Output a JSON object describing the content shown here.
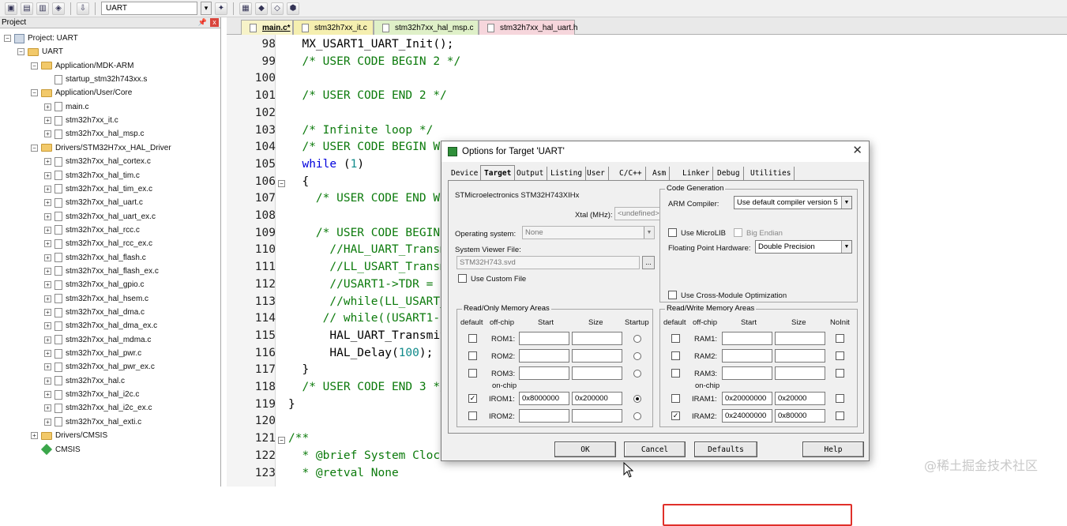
{
  "toolbar": {
    "target": "UART",
    "icons": [
      "save-all-icon",
      "target-options-icon",
      "manage-icon",
      "batch-build-icon",
      "load-icon",
      "select-target-icon",
      "options-icon",
      "multi-project-icon",
      "pack-installer-icon",
      "components-icon",
      "run-env-icon"
    ]
  },
  "project": {
    "header": "Project",
    "tree": [
      {
        "label": "Project: UART",
        "level": 0,
        "kind": "proj",
        "exp": "-"
      },
      {
        "label": "UART",
        "level": 1,
        "kind": "folder",
        "exp": "-"
      },
      {
        "label": "Application/MDK-ARM",
        "level": 2,
        "kind": "folder",
        "exp": "-"
      },
      {
        "label": "startup_stm32h743xx.s",
        "level": 3,
        "kind": "file",
        "exp": ""
      },
      {
        "label": "Application/User/Core",
        "level": 2,
        "kind": "folder",
        "exp": "-"
      },
      {
        "label": "main.c",
        "level": 3,
        "kind": "file",
        "exp": "+"
      },
      {
        "label": "stm32h7xx_it.c",
        "level": 3,
        "kind": "file",
        "exp": "+"
      },
      {
        "label": "stm32h7xx_hal_msp.c",
        "level": 3,
        "kind": "file",
        "exp": "+"
      },
      {
        "label": "Drivers/STM32H7xx_HAL_Driver",
        "level": 2,
        "kind": "folder",
        "exp": "-"
      },
      {
        "label": "stm32h7xx_hal_cortex.c",
        "level": 3,
        "kind": "file",
        "exp": "+"
      },
      {
        "label": "stm32h7xx_hal_tim.c",
        "level": 3,
        "kind": "file",
        "exp": "+"
      },
      {
        "label": "stm32h7xx_hal_tim_ex.c",
        "level": 3,
        "kind": "file",
        "exp": "+"
      },
      {
        "label": "stm32h7xx_hal_uart.c",
        "level": 3,
        "kind": "file",
        "exp": "+"
      },
      {
        "label": "stm32h7xx_hal_uart_ex.c",
        "level": 3,
        "kind": "file",
        "exp": "+"
      },
      {
        "label": "stm32h7xx_hal_rcc.c",
        "level": 3,
        "kind": "file",
        "exp": "+"
      },
      {
        "label": "stm32h7xx_hal_rcc_ex.c",
        "level": 3,
        "kind": "file",
        "exp": "+"
      },
      {
        "label": "stm32h7xx_hal_flash.c",
        "level": 3,
        "kind": "file",
        "exp": "+"
      },
      {
        "label": "stm32h7xx_hal_flash_ex.c",
        "level": 3,
        "kind": "file",
        "exp": "+"
      },
      {
        "label": "stm32h7xx_hal_gpio.c",
        "level": 3,
        "kind": "file",
        "exp": "+"
      },
      {
        "label": "stm32h7xx_hal_hsem.c",
        "level": 3,
        "kind": "file",
        "exp": "+"
      },
      {
        "label": "stm32h7xx_hal_dma.c",
        "level": 3,
        "kind": "file",
        "exp": "+"
      },
      {
        "label": "stm32h7xx_hal_dma_ex.c",
        "level": 3,
        "kind": "file",
        "exp": "+"
      },
      {
        "label": "stm32h7xx_hal_mdma.c",
        "level": 3,
        "kind": "file",
        "exp": "+"
      },
      {
        "label": "stm32h7xx_hal_pwr.c",
        "level": 3,
        "kind": "file",
        "exp": "+"
      },
      {
        "label": "stm32h7xx_hal_pwr_ex.c",
        "level": 3,
        "kind": "file",
        "exp": "+"
      },
      {
        "label": "stm32h7xx_hal.c",
        "level": 3,
        "kind": "file",
        "exp": "+"
      },
      {
        "label": "stm32h7xx_hal_i2c.c",
        "level": 3,
        "kind": "file",
        "exp": "+"
      },
      {
        "label": "stm32h7xx_hal_i2c_ex.c",
        "level": 3,
        "kind": "file",
        "exp": "+"
      },
      {
        "label": "stm32h7xx_hal_exti.c",
        "level": 3,
        "kind": "file",
        "exp": "+"
      },
      {
        "label": "Drivers/CMSIS",
        "level": 2,
        "kind": "folder",
        "exp": "+"
      },
      {
        "label": "CMSIS",
        "level": 2,
        "kind": "gem",
        "exp": ""
      }
    ]
  },
  "editor": {
    "tabs": [
      {
        "label": "main.c*",
        "bg": "#f7f3c8",
        "active": true
      },
      {
        "label": "stm32h7xx_it.c",
        "bg": "#f5efb0",
        "active": false
      },
      {
        "label": "stm32h7xx_hal_msp.c",
        "bg": "#dff0c8",
        "active": false
      },
      {
        "label": "stm32h7xx_hal_uart.h",
        "bg": "#f6d6dc",
        "active": false
      }
    ],
    "lines": [
      {
        "n": "98",
        "fold": "",
        "segs": [
          {
            "t": "  MX_USART1_UART_Init();",
            "c": ""
          }
        ]
      },
      {
        "n": "99",
        "fold": "",
        "segs": [
          {
            "t": "  /* USER CODE BEGIN 2 */",
            "c": "cmt"
          }
        ]
      },
      {
        "n": "100",
        "fold": "",
        "segs": []
      },
      {
        "n": "101",
        "fold": "",
        "segs": [
          {
            "t": "  /* USER CODE END 2 */",
            "c": "cmt"
          }
        ]
      },
      {
        "n": "102",
        "fold": "",
        "segs": []
      },
      {
        "n": "103",
        "fold": "",
        "segs": [
          {
            "t": "  /* Infinite loop */",
            "c": "cmt"
          }
        ]
      },
      {
        "n": "104",
        "fold": "",
        "segs": [
          {
            "t": "  /* USER CODE BEGIN WH",
            "c": "cmt"
          }
        ]
      },
      {
        "n": "105",
        "fold": "",
        "segs": [
          {
            "t": "  ",
            "c": ""
          },
          {
            "t": "while",
            "c": "kw"
          },
          {
            "t": " (",
            "c": ""
          },
          {
            "t": "1",
            "c": "num"
          },
          {
            "t": ")",
            "c": ""
          }
        ]
      },
      {
        "n": "106",
        "fold": "-",
        "segs": [
          {
            "t": "  {",
            "c": ""
          }
        ]
      },
      {
        "n": "107",
        "fold": "",
        "segs": [
          {
            "t": "    /* USER CODE END WH",
            "c": "cmt"
          }
        ]
      },
      {
        "n": "108",
        "fold": "",
        "segs": []
      },
      {
        "n": "109",
        "fold": "",
        "segs": [
          {
            "t": "    /* USER CODE BEGIN",
            "c": "cmt"
          }
        ]
      },
      {
        "n": "110",
        "fold": "",
        "segs": [
          {
            "t": "      //HAL_UART_Transm",
            "c": "cmt"
          }
        ]
      },
      {
        "n": "111",
        "fold": "",
        "segs": [
          {
            "t": "      //LL_USART_Transm",
            "c": "cmt"
          }
        ]
      },
      {
        "n": "112",
        "fold": "",
        "segs": [
          {
            "t": "      //USART1->TDR = ",
            "c": "cmt"
          }
        ]
      },
      {
        "n": "113",
        "fold": "",
        "segs": [
          {
            "t": "      //while(LL_USART_",
            "c": "cmt"
          }
        ]
      },
      {
        "n": "114",
        "fold": "",
        "segs": [
          {
            "t": "     // while((USART1-:",
            "c": "cmt"
          }
        ]
      },
      {
        "n": "115",
        "fold": "",
        "segs": [
          {
            "t": "      HAL_UART_Transmit",
            "c": ""
          }
        ]
      },
      {
        "n": "116",
        "fold": "",
        "segs": [
          {
            "t": "      HAL_Delay(",
            "c": ""
          },
          {
            "t": "100",
            "c": "num"
          },
          {
            "t": ");",
            "c": ""
          }
        ]
      },
      {
        "n": "117",
        "fold": "",
        "segs": [
          {
            "t": "  }",
            "c": ""
          }
        ]
      },
      {
        "n": "118",
        "fold": "",
        "segs": [
          {
            "t": "  /* USER CODE END 3 */",
            "c": "cmt"
          }
        ]
      },
      {
        "n": "119",
        "fold": "",
        "segs": [
          {
            "t": "}",
            "c": ""
          }
        ]
      },
      {
        "n": "120",
        "fold": "",
        "segs": []
      },
      {
        "n": "121",
        "fold": "-",
        "segs": [
          {
            "t": "/**",
            "c": "cmt"
          }
        ]
      },
      {
        "n": "122",
        "fold": "",
        "segs": [
          {
            "t": "  * @brief System Clock",
            "c": "cmt"
          }
        ]
      },
      {
        "n": "123",
        "fold": "",
        "segs": [
          {
            "t": "  * @retval None",
            "c": "cmt"
          }
        ]
      }
    ]
  },
  "dialog": {
    "title": "Options for Target 'UART'",
    "close": "✕",
    "tabs": [
      "Device",
      "Target",
      "Output",
      "Listing",
      "User",
      "C/C++",
      "Asm",
      "Linker",
      "Debug",
      "Utilities"
    ],
    "active_tab": "Target",
    "device_name": "STMicroelectronics STM32H743XIHx",
    "xtal_label": "Xtal (MHz):",
    "xtal_value": "<undefined>",
    "os_label": "Operating system:",
    "os_value": "None",
    "svf_label": "System Viewer File:",
    "svf_value": "STM32H743.svd",
    "browse": "...",
    "use_custom_file": "Use Custom File",
    "codegen": {
      "title": "Code Generation",
      "compiler_label": "ARM Compiler:",
      "compiler_value": "Use default compiler version 5",
      "microlib": "Use MicroLIB",
      "big_endian": "Big Endian",
      "fp_label": "Floating Point Hardware:",
      "fp_value": "Double Precision",
      "cross_module": "Use Cross-Module Optimization"
    },
    "rom": {
      "title": "Read/Only Memory Areas",
      "headers": {
        "default": "default",
        "offchip": "off-chip",
        "start": "Start",
        "size": "Size",
        "startup": "Startup"
      },
      "onchip_label": "on-chip",
      "rows": [
        {
          "name": "ROM1:",
          "default": false,
          "start": "",
          "size": "",
          "startup": false
        },
        {
          "name": "ROM2:",
          "default": false,
          "start": "",
          "size": "",
          "startup": false
        },
        {
          "name": "ROM3:",
          "default": false,
          "start": "",
          "size": "",
          "startup": false
        },
        {
          "name": "IROM1:",
          "default": true,
          "start": "0x8000000",
          "size": "0x200000",
          "startup": true
        },
        {
          "name": "IROM2:",
          "default": false,
          "start": "",
          "size": "",
          "startup": false
        }
      ]
    },
    "ram": {
      "title": "Read/Write Memory Areas",
      "headers": {
        "default": "default",
        "offchip": "off-chip",
        "start": "Start",
        "size": "Size",
        "noinit": "NoInit"
      },
      "onchip_label": "on-chip",
      "rows": [
        {
          "name": "RAM1:",
          "default": false,
          "start": "",
          "size": "",
          "noinit": false
        },
        {
          "name": "RAM2:",
          "default": false,
          "start": "",
          "size": "",
          "noinit": false
        },
        {
          "name": "RAM3:",
          "default": false,
          "start": "",
          "size": "",
          "noinit": false
        },
        {
          "name": "IRAM1:",
          "default": false,
          "start": "0x20000000",
          "size": "0x20000",
          "noinit": false
        },
        {
          "name": "IRAM2:",
          "default": true,
          "start": "0x24000000",
          "size": "0x80000",
          "noinit": false
        }
      ]
    },
    "buttons": {
      "ok": "OK",
      "cancel": "Cancel",
      "defaults": "Defaults",
      "help": "Help"
    }
  },
  "watermark": "@稀土掘金技术社区",
  "colors": {
    "highlight": "#e0302a",
    "comment": "#0b7a0b",
    "keyword": "#0000dd",
    "number": "#0f8a8a"
  }
}
